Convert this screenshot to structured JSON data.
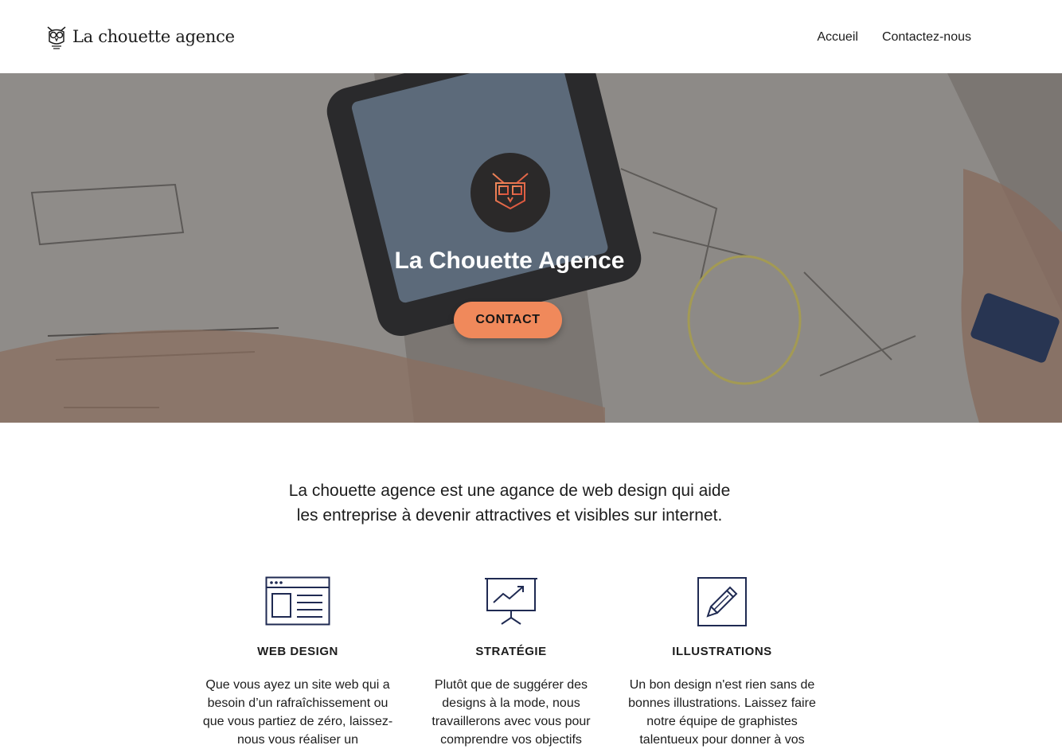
{
  "header": {
    "logo_text": "La chouette agence",
    "nav": [
      "Accueil",
      "Contactez-nous"
    ]
  },
  "hero": {
    "title": "La Chouette Agence",
    "button_label": "CONTACT"
  },
  "intro": {
    "text": "La chouette agence est une agance de web design qui aide les entreprise à devenir attractives et visibles sur internet."
  },
  "services": [
    {
      "icon": "web-design-icon",
      "title": "WEB DESIGN",
      "text": "Que vous ayez un site web qui a besoin d’un rafraîchissement ou que vous partiez de zéro, laissez-nous vous réaliser un"
    },
    {
      "icon": "strategy-chart-icon",
      "title": "STRATÉGIE",
      "text": "Plutôt que de suggérer des designs à la mode, nous travaillerons avec vous pour comprendre vos objectifs"
    },
    {
      "icon": "pencil-icon",
      "title": "ILLUSTRATIONS",
      "text": "Un bon design n'est rien sans de bonnes illustrations. Laissez faire notre équipe de graphistes talentueux pour donner à vos"
    }
  ],
  "colors": {
    "accent": "#f0895b",
    "icon_stroke": "#1f2a52",
    "badge_bg": "#2b2929"
  }
}
